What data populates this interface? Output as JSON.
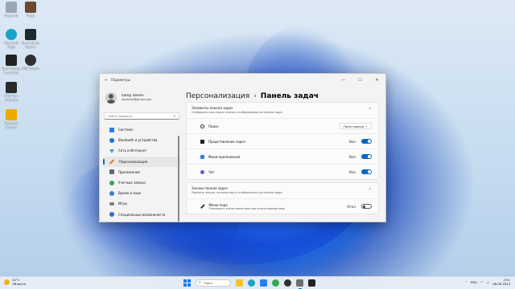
{
  "desktop": {
    "icons": [
      {
        "label": "Корзина",
        "color": "#9aa7b5",
        "icon": "recycle-bin-icon"
      },
      {
        "label": "Dogs",
        "color": "#6b4a2f",
        "icon": "dogs-game-icon"
      },
      {
        "label": "Microsoft Edge",
        "color": "#1aa3c9",
        "icon": "edge-icon"
      },
      {
        "label": "SecondLife Viewer",
        "color": "#1d2b2f",
        "icon": "secondlife-icon"
      },
      {
        "label": "Epic Games Launcher",
        "color": "#222222",
        "icon": "epic-games-icon"
      },
      {
        "label": "OBS Studio",
        "color": "#303030",
        "icon": "obs-icon"
      },
      {
        "label": "GTA San Andreas",
        "color": "#2a2a2a",
        "icon": "gta-sa-icon"
      },
      {
        "label": "Rockstar Games",
        "color": "#f0a900",
        "icon": "rockstar-icon"
      }
    ]
  },
  "window": {
    "title": "Параметры",
    "back_icon": "back-arrow-icon",
    "minimize": "—",
    "maximize": "☐",
    "close": "✕"
  },
  "user": {
    "name": "samp denen",
    "email": "studentd@gmail.com"
  },
  "search": {
    "placeholder": "Найти параметр"
  },
  "nav": [
    {
      "label": "Система",
      "color": "#2b7de9",
      "icon": "monitor-icon"
    },
    {
      "label": "Bluetooth и устройства",
      "color": "#1a73e8",
      "icon": "bluetooth-icon"
    },
    {
      "label": "Сеть и Интернет",
      "color": "#2aa3d8",
      "icon": "network-icon"
    },
    {
      "label": "Персонализация",
      "color": "#e07a2b",
      "icon": "brush-icon"
    },
    {
      "label": "Приложения",
      "color": "#5b6b7a",
      "icon": "apps-icon"
    },
    {
      "label": "Учетные записи",
      "color": "#2fa35b",
      "icon": "account-icon"
    },
    {
      "label": "Время и язык",
      "color": "#3b7fd1",
      "icon": "globe-clock-icon"
    },
    {
      "label": "Игры",
      "color": "#7a7a7a",
      "icon": "gamepad-icon"
    },
    {
      "label": "Специальные возможности",
      "color": "#2d6fd6",
      "icon": "accessibility-icon"
    }
  ],
  "selected_nav": 3,
  "breadcrumb": {
    "parent": "Персонализация",
    "separator": "›",
    "current": "Панель задач"
  },
  "sections": {
    "elements": {
      "title": "Элементы панели задач",
      "subtitle": "Отобразить или скрыть кнопки, отображаемые на панели задач",
      "rows": [
        {
          "label": "Поиск",
          "value": "Поле поиска",
          "icon": "search-icon",
          "color": "#333333"
        },
        {
          "label": "Представление задач",
          "value": "Вкл.",
          "icon": "task-view-icon",
          "color": "#222222"
        },
        {
          "label": "Мини-приложения",
          "value": "Вкл.",
          "icon": "widgets-icon",
          "color": "#2f80ed"
        },
        {
          "label": "Чат",
          "value": "Вкл.",
          "icon": "chat-icon",
          "color": "#6a5acd"
        }
      ]
    },
    "corner_icons": {
      "title": "Значки панели задач",
      "subtitle": "Показать значки, которые могут отображаться на панели задач",
      "rows": [
        {
          "label": "Меню пера",
          "sublabel": "Показывать значок меню пера при использовании пера",
          "value": "Откл.",
          "icon": "pen-icon",
          "color": "#333333"
        }
      ]
    }
  },
  "taskbar": {
    "weather": {
      "temp": "14°C",
      "condition": "Облачно"
    },
    "search_label": "Поиск",
    "apps": [
      {
        "name": "file-explorer",
        "color": "#f4c430"
      },
      {
        "name": "edge",
        "color": "#1aa3c9"
      },
      {
        "name": "store",
        "color": "#2b7de9"
      },
      {
        "name": "chrome",
        "color": "#34a853"
      },
      {
        "name": "obs",
        "color": "#303030"
      },
      {
        "name": "settings",
        "color": "#6d6d6d"
      },
      {
        "name": "terminal",
        "color": "#222222"
      }
    ],
    "lang": "ENG",
    "time": "2:51",
    "date": "08.06.2023"
  },
  "colors": {
    "accent": "#0067c0",
    "wallpaper_bloom": "#1e73f0"
  }
}
